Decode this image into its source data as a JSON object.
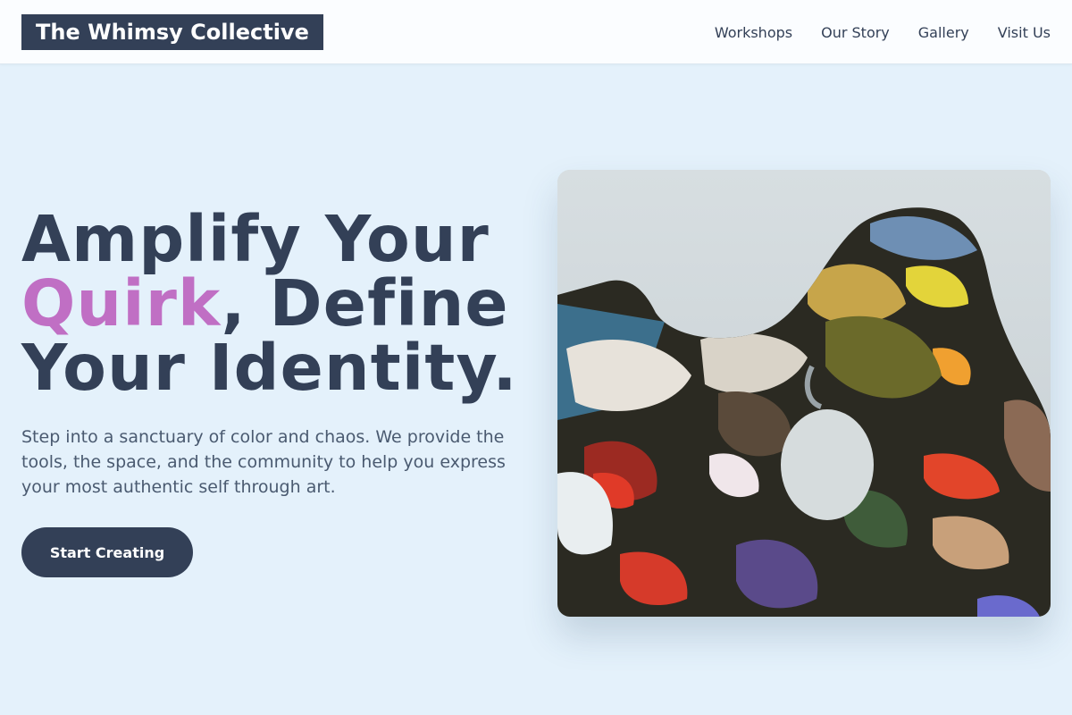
{
  "header": {
    "brand": "The Whimsy Collective",
    "nav": [
      {
        "label": "Workshops"
      },
      {
        "label": "Our Story"
      },
      {
        "label": "Gallery"
      },
      {
        "label": "Visit Us"
      }
    ]
  },
  "hero": {
    "headline_line1": "Amplify Your",
    "headline_accent": "Quirk",
    "headline_line2_rest": ", Define",
    "headline_line3": "Your Identity.",
    "description": "Step into a sanctuary of color and chaos. We provide the tools, the space, and the community to help you express your most authentic self through art.",
    "cta_label": "Start Creating",
    "image_subject": "paint palette with thick colorful oil paint"
  },
  "colors": {
    "page_background": "#e4f1fb",
    "primary": "#334057",
    "accent": "#c06fc4",
    "text_muted": "#4a5a70"
  }
}
